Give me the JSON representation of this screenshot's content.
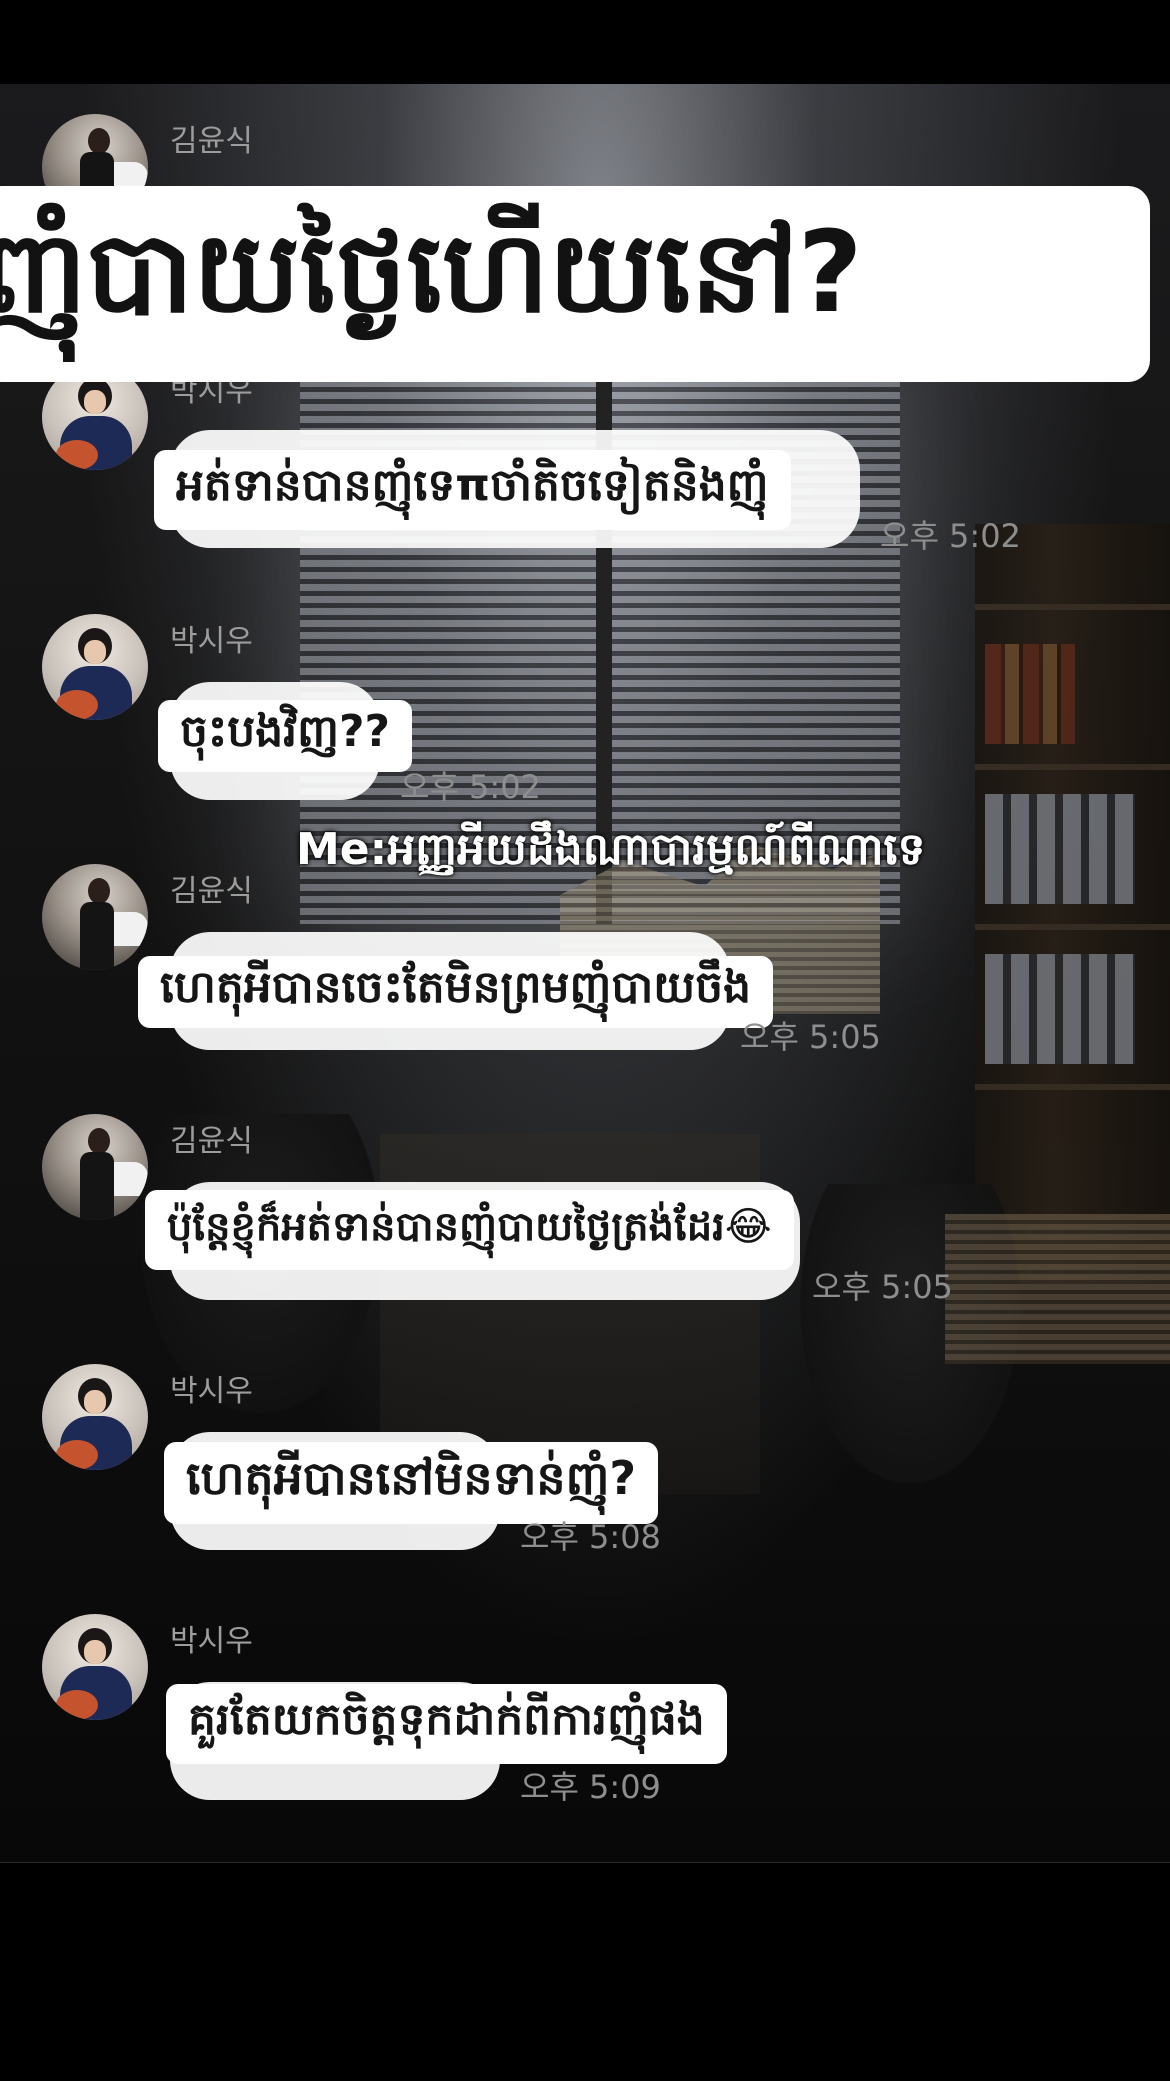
{
  "banner": {
    "text": "ញុំបាយថ្ងៃហើយនៅ?"
  },
  "caption": {
    "text": "Me:អញ្ញអីយដឹងណាបារម្មណ៍ពីណាទេ"
  },
  "messages": [
    {
      "sender": "김윤식",
      "avatar": "kim",
      "text": "",
      "time": ""
    },
    {
      "sender": "박시우",
      "avatar": "park",
      "text": "អត់ទាន់បានញុំទេπចាំតិចទៀតនិងញុំ",
      "time": "오후 5:02"
    },
    {
      "sender": "박시우",
      "avatar": "park",
      "text": "ចុះបងវិញ??",
      "time": "오후 5:02"
    },
    {
      "sender": "김윤식",
      "avatar": "kim",
      "text": "ហេតុអីបានចេះតែមិនព្រមញុំបាយចឹង",
      "time": "오후 5:05"
    },
    {
      "sender": "김윤식",
      "avatar": "kim",
      "text": "ប៉ុន្តែខ្ញុំក៏អត់ទាន់បានញុំបាយថ្ងៃត្រង់ដែរ😂",
      "time": "오후 5:05"
    },
    {
      "sender": "박시우",
      "avatar": "park",
      "text": "ហេតុអីបាននៅមិនទាន់ញុំ?",
      "time": "오후 5:08"
    },
    {
      "sender": "박시우",
      "avatar": "park",
      "text": "គួរតែយកចិត្តទុកដាក់ពីការញុំផង",
      "time": "오후 5:09"
    }
  ]
}
